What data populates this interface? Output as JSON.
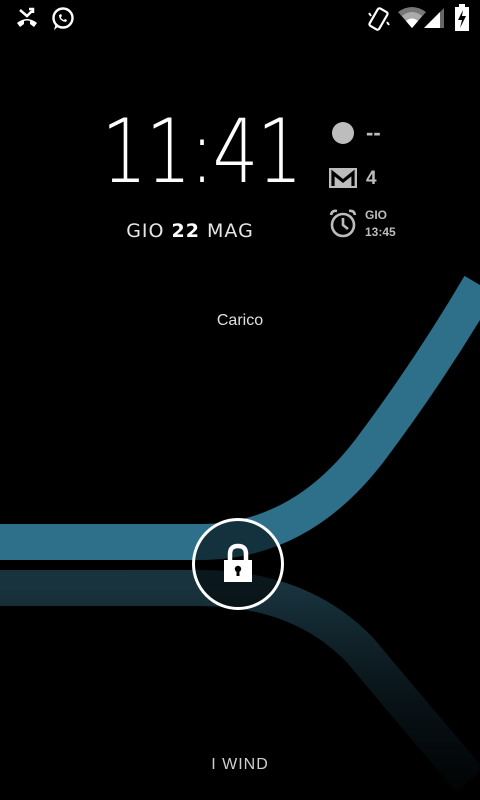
{
  "status_bar": {
    "left_icons": [
      "missed-call-icon",
      "whatsapp-icon"
    ],
    "right_icons": [
      "phone-vibrate-icon",
      "wifi-icon",
      "signal-icon",
      "battery-charging-icon"
    ]
  },
  "lockscreen": {
    "time": "11:41",
    "date_day": "GIO",
    "date_num": "22",
    "date_month": "MAG",
    "weather_value": "--",
    "gmail_count": "4",
    "alarm_day": "GIO",
    "alarm_time": "13:45",
    "status_message": "Carico",
    "carrier": "I WIND",
    "accent_color": "#2e6f8a"
  }
}
